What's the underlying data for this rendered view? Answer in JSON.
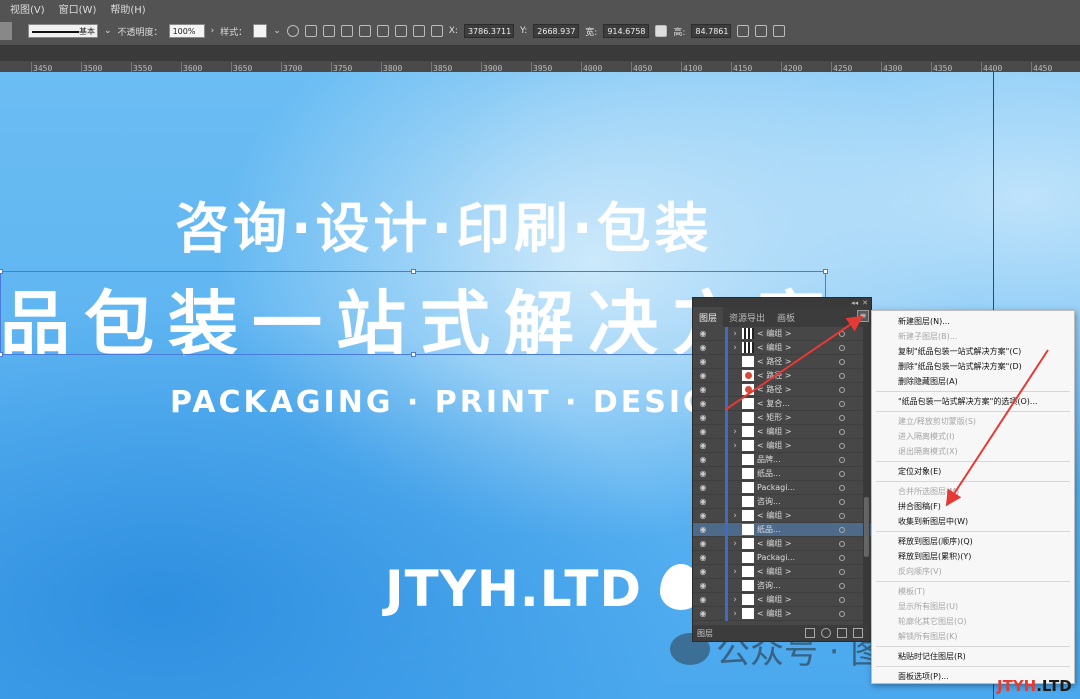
{
  "menubar": {
    "items": [
      "视图(V)",
      "窗口(W)",
      "帮助(H)"
    ]
  },
  "controlbar": {
    "stroke_style": "基本",
    "opacity_label": "不透明度：",
    "opacity_value": "100%",
    "style_label": "样式：",
    "x_label": "X:",
    "x_value": "3786.3711",
    "y_label": "Y:",
    "y_value": "2668.937",
    "w_label": "宽:",
    "w_value": "914.6758",
    "h_label": "高:",
    "h_value": "84.7861"
  },
  "ruler": {
    "labels": [
      "3450",
      "3500",
      "3550",
      "3600",
      "3650",
      "3700",
      "3750",
      "3800",
      "3850",
      "3900",
      "3950",
      "4000",
      "4050",
      "4100",
      "4150",
      "4200",
      "4250",
      "4300",
      "4350",
      "4400",
      "4450"
    ]
  },
  "canvas": {
    "headline1": "咨询·设计·印刷·包装",
    "headline2": "品包装一站式解决方案",
    "english": "PACKAGING · PRINT · DESIGN ·",
    "logo": "JTYH.LTD"
  },
  "layers_panel": {
    "tabs": [
      "图层",
      "资源导出",
      "画板"
    ],
    "footer_label": "图层",
    "rows": [
      {
        "name": "< 编组 >",
        "exp": true,
        "thumb": "dark"
      },
      {
        "name": "< 编组 >",
        "exp": true,
        "thumb": "dark"
      },
      {
        "name": "< 路径 >",
        "exp": false,
        "thumb": "white"
      },
      {
        "name": "< 路径 >",
        "exp": false,
        "thumb": "red"
      },
      {
        "name": "< 路径 >",
        "exp": false,
        "thumb": "red"
      },
      {
        "name": "< 复合...",
        "exp": false,
        "thumb": "white"
      },
      {
        "name": "< 矩形 >",
        "exp": false,
        "thumb": "white"
      },
      {
        "name": "< 编组 >",
        "exp": true,
        "thumb": "white"
      },
      {
        "name": "< 编组 >",
        "exp": true,
        "thumb": "white"
      },
      {
        "name": "品牌...",
        "exp": false,
        "thumb": "white"
      },
      {
        "name": "纸品...",
        "exp": false,
        "thumb": "white"
      },
      {
        "name": "Packagi...",
        "exp": false,
        "thumb": "white"
      },
      {
        "name": "咨询...",
        "exp": false,
        "thumb": "white"
      },
      {
        "name": "< 编组 >",
        "exp": true,
        "thumb": "white"
      },
      {
        "name": "纸品...",
        "exp": false,
        "thumb": "white",
        "selected": true
      },
      {
        "name": "< 编组 >",
        "exp": true,
        "thumb": "white"
      },
      {
        "name": "Packagi...",
        "exp": false,
        "thumb": "white"
      },
      {
        "name": "< 编组 >",
        "exp": true,
        "thumb": "white"
      },
      {
        "name": "咨询...",
        "exp": false,
        "thumb": "white"
      },
      {
        "name": "< 编组 >",
        "exp": true,
        "thumb": "white"
      },
      {
        "name": "< 编组 >",
        "exp": true,
        "thumb": "white"
      }
    ]
  },
  "context_menu": {
    "groups": [
      [
        {
          "label": "新建图层(N)...",
          "enabled": true
        },
        {
          "label": "新建子图层(B)...",
          "enabled": false
        },
        {
          "label": "复制\"纸品包装一站式解决方案\"(C)",
          "enabled": true
        },
        {
          "label": "删除\"纸品包装一站式解决方案\"(D)",
          "enabled": true
        },
        {
          "label": "删除隐藏图层(A)",
          "enabled": true
        }
      ],
      [
        {
          "label": "\"纸品包装一站式解决方案\"的选项(O)...",
          "enabled": true
        }
      ],
      [
        {
          "label": "建立/释放剪切蒙版(S)",
          "enabled": false
        },
        {
          "label": "进入隔离模式(I)",
          "enabled": false
        },
        {
          "label": "退出隔离模式(X)",
          "enabled": false
        }
      ],
      [
        {
          "label": "定位对象(E)",
          "enabled": true
        }
      ],
      [
        {
          "label": "合并所选图层(M)",
          "enabled": false
        },
        {
          "label": "拼合图稿(F)",
          "enabled": true
        },
        {
          "label": "收集到新图层中(W)",
          "enabled": true
        }
      ],
      [
        {
          "label": "释放到图层(顺序)(Q)",
          "enabled": true
        },
        {
          "label": "释放到图层(累积)(Y)",
          "enabled": true
        },
        {
          "label": "反向顺序(V)",
          "enabled": false
        }
      ],
      [
        {
          "label": "模板(T)",
          "enabled": false
        },
        {
          "label": "显示所有图层(U)",
          "enabled": false
        },
        {
          "label": "轮廓化其它图层(O)",
          "enabled": false
        },
        {
          "label": "解锁所有图层(K)",
          "enabled": false
        }
      ],
      [
        {
          "label": "粘贴时记住图层(R)",
          "enabled": true
        }
      ],
      [
        {
          "label": "面板选项(P)...",
          "enabled": true
        }
      ]
    ]
  },
  "watermark": {
    "text": "公众号 · 图图印画"
  },
  "corner_logo": {
    "red": "JTYH",
    "dark": ".LTD"
  },
  "colors": {
    "canvas_blue": "#5db4f1",
    "arrow_red": "#e53935",
    "selection_blue": "#4b7bd8"
  }
}
